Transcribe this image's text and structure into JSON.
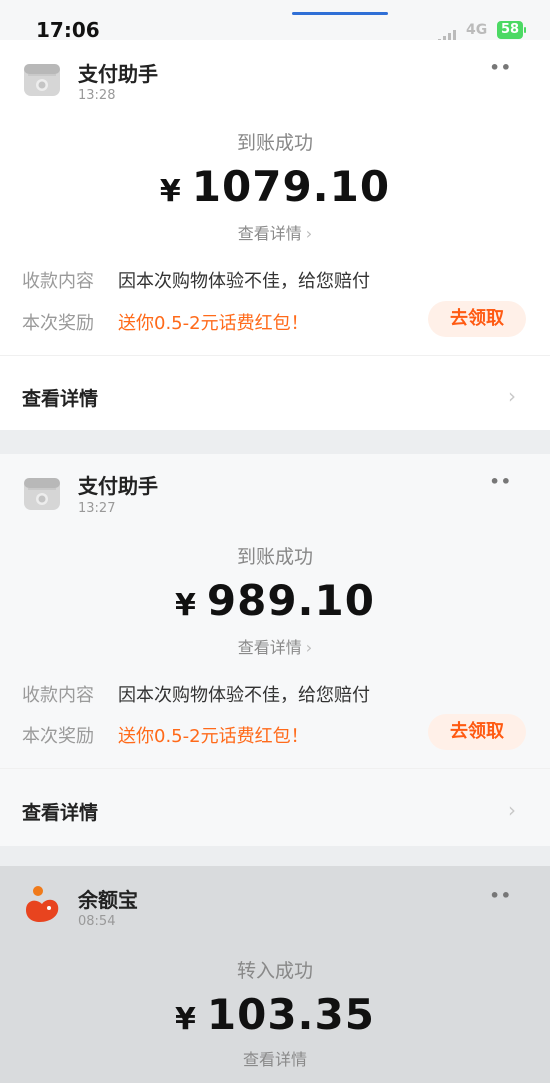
{
  "status_bar": {
    "time": "17:06",
    "network": "4G",
    "battery": "58"
  },
  "cards": [
    {
      "source": "支付助手",
      "time": "13:28",
      "status": "到账成功",
      "currency": "¥",
      "amount": "1079.10",
      "detail_link": "查看详情",
      "content_label": "收款内容",
      "content_value": "因本次购物体验不佳，给您赔付",
      "reward_label": "本次奖励",
      "reward_value": "送你0.5-2元话费红包！",
      "claim_button": "去领取",
      "view_detail": "查看详情"
    },
    {
      "source": "支付助手",
      "time": "13:27",
      "status": "到账成功",
      "currency": "¥",
      "amount": "989.10",
      "detail_link": "查看详情",
      "content_label": "收款内容",
      "content_value": "因本次购物体验不佳，给您赔付",
      "reward_label": "本次奖励",
      "reward_value": "送你0.5-2元话费红包！",
      "claim_button": "去领取",
      "view_detail": "查看详情"
    },
    {
      "source": "余额宝",
      "time": "08:54",
      "status": "转入成功",
      "currency": "¥",
      "amount": "103.35",
      "detail_link": "查看详情"
    }
  ],
  "icons": {
    "store": "store-icon",
    "yuebao": "yuebao-icon",
    "more": "more-icon",
    "chevron": "chevron-right-icon"
  }
}
